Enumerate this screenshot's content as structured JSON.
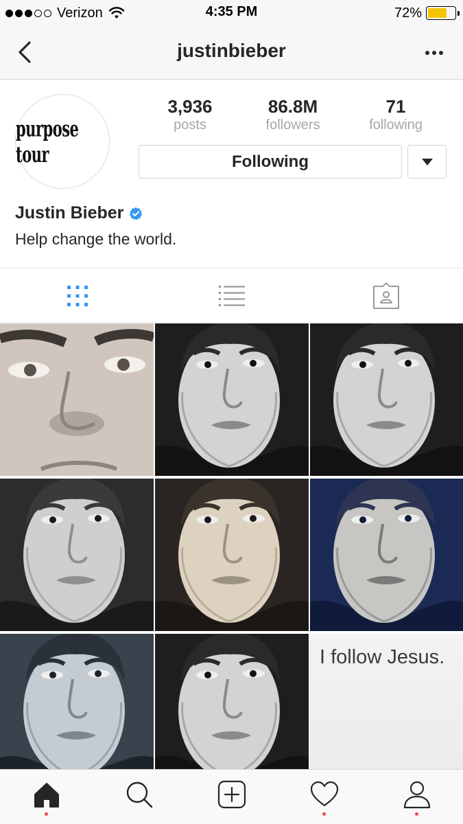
{
  "status_bar": {
    "carrier": "Verizon",
    "time": "4:35 PM",
    "battery_percent": "72%",
    "battery_level": 0.72,
    "signal_bars_filled": 3,
    "signal_bars_total": 5
  },
  "nav": {
    "back_icon": "chevron-left-icon",
    "title": "justinbieber",
    "more_icon": "ellipsis-icon"
  },
  "profile": {
    "avatar_text": "purpose tour",
    "stats": [
      {
        "value": "3,936",
        "label": "posts"
      },
      {
        "value": "86.8M",
        "label": "followers"
      },
      {
        "value": "71",
        "label": "following"
      }
    ],
    "follow_button_label": "Following",
    "full_name": "Justin Bieber",
    "verified": true,
    "bio": "Help change the world."
  },
  "view_tabs": [
    {
      "name": "grid-view",
      "icon": "grid-icon",
      "active": true
    },
    {
      "name": "list-view",
      "icon": "list-icon",
      "active": false
    },
    {
      "name": "tagged-view",
      "icon": "tagged-photos-icon",
      "active": false
    }
  ],
  "grid_posts": [
    {
      "type": "photo",
      "tone": "warm-gray"
    },
    {
      "type": "photo",
      "tone": "dark"
    },
    {
      "type": "photo",
      "tone": "dark"
    },
    {
      "type": "photo",
      "tone": "gray"
    },
    {
      "type": "photo",
      "tone": "warm"
    },
    {
      "type": "photo",
      "tone": "blue"
    },
    {
      "type": "photo",
      "tone": "cool-gray"
    },
    {
      "type": "photo",
      "tone": "dark"
    },
    {
      "type": "text",
      "text": "I follow Jesus."
    }
  ],
  "bottom_tabs": [
    {
      "name": "home",
      "icon": "home-icon",
      "notification": true
    },
    {
      "name": "search",
      "icon": "search-icon",
      "notification": false
    },
    {
      "name": "create",
      "icon": "plus-square-icon",
      "notification": false
    },
    {
      "name": "activity",
      "icon": "heart-icon",
      "notification": true
    },
    {
      "name": "profile",
      "icon": "person-icon",
      "notification": true
    }
  ],
  "colors": {
    "accent_blue": "#3897f0",
    "notification_red": "#ed4956",
    "battery_yellow": "#f5c400",
    "text": "#262626",
    "muted": "#a6a6a6"
  }
}
